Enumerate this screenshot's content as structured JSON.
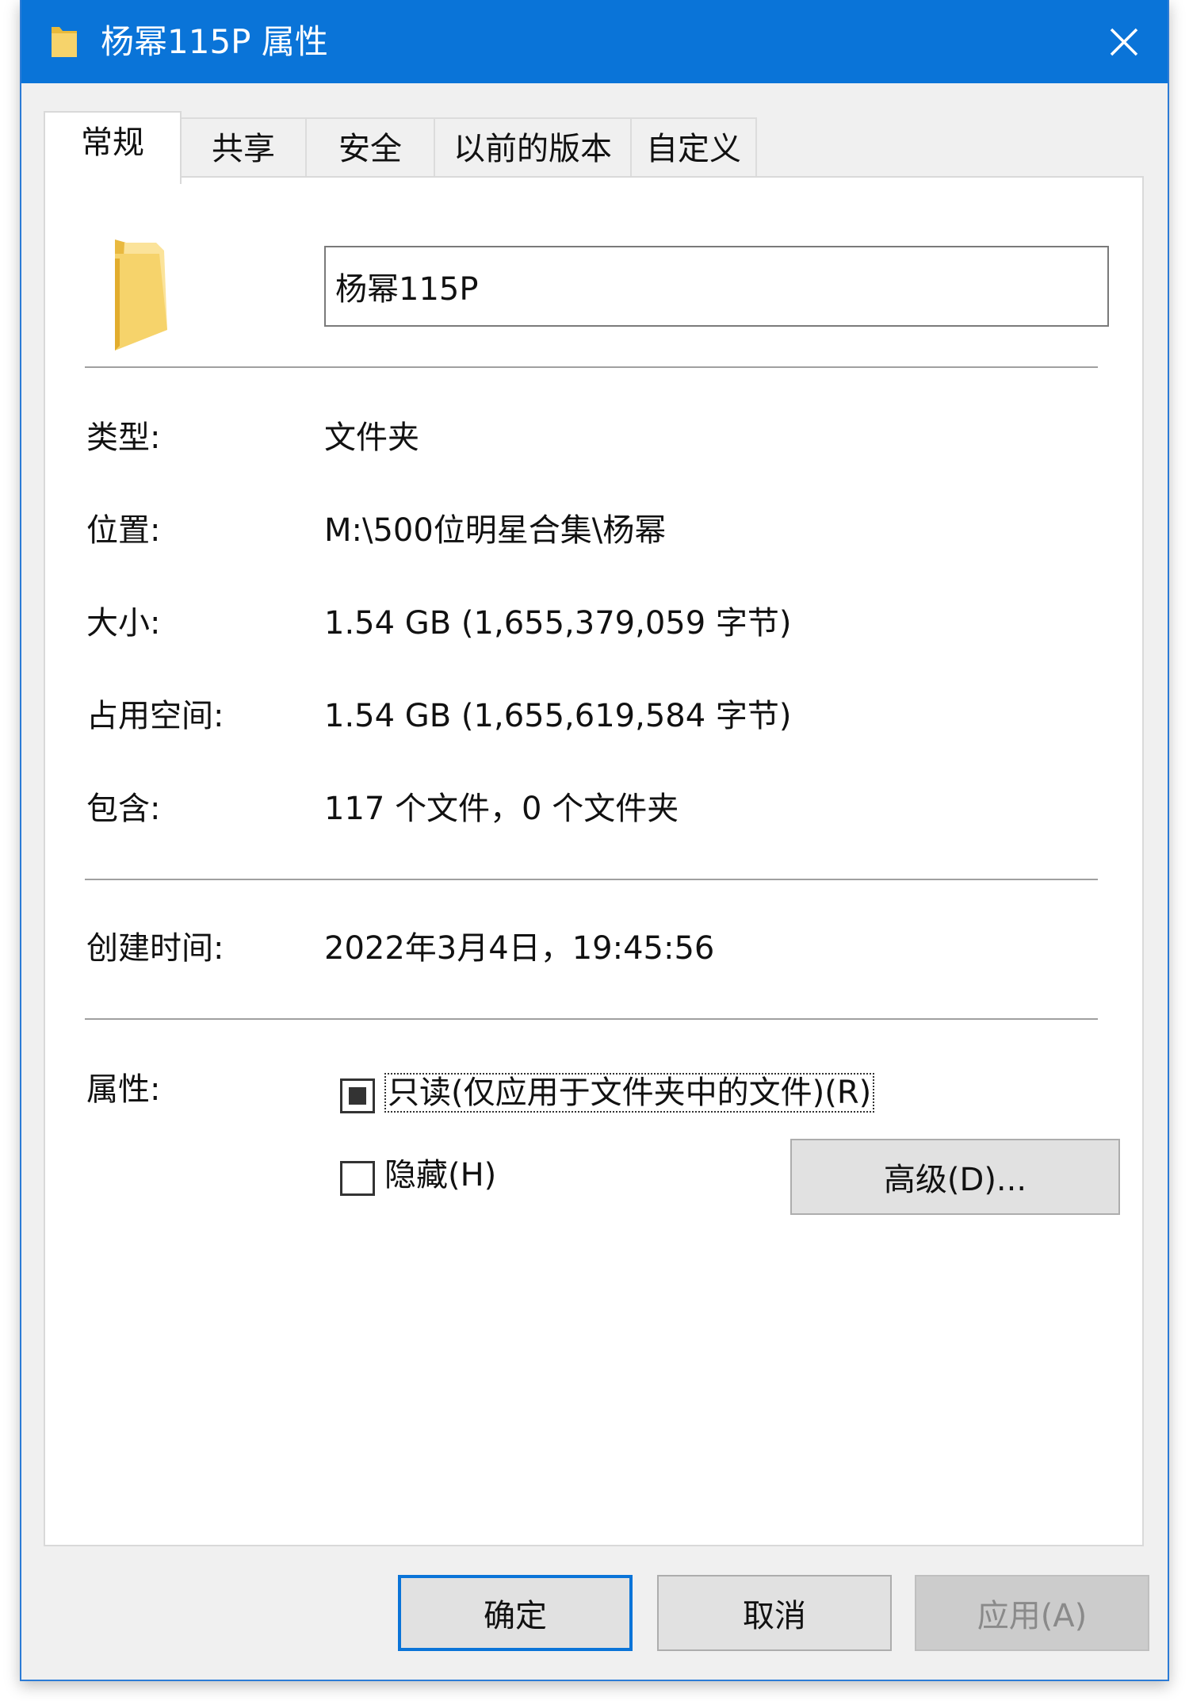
{
  "window": {
    "title": "杨幂115P 属性"
  },
  "tabs": [
    {
      "label": "常规",
      "active": true
    },
    {
      "label": "共享",
      "active": false
    },
    {
      "label": "安全",
      "active": false
    },
    {
      "label": "以前的版本",
      "active": false
    },
    {
      "label": "自定义",
      "active": false
    }
  ],
  "general": {
    "name_value": "杨幂115P",
    "rows": [
      {
        "label": "类型:",
        "value": "文件夹"
      },
      {
        "label": "位置:",
        "value": "M:\\500位明星合集\\杨幂"
      },
      {
        "label": "大小:",
        "value": "1.54 GB (1,655,379,059 字节)"
      },
      {
        "label": "占用空间:",
        "value": "1.54 GB (1,655,619,584 字节)"
      },
      {
        "label": "包含:",
        "value": "117 个文件，0 个文件夹"
      }
    ],
    "created": {
      "label": "创建时间:",
      "value": "2022年3月4日，19:45:56"
    },
    "attributes": {
      "label": "属性:",
      "readonly_label": "只读(仅应用于文件夹中的文件)(R)",
      "readonly_state": "indeterminate",
      "hidden_label": "隐藏(H)",
      "hidden_state": "unchecked",
      "advanced_button": "高级(D)..."
    }
  },
  "footer": {
    "ok": "确定",
    "cancel": "取消",
    "apply": "应用(A)"
  },
  "colors": {
    "titlebar": "#0a74d8",
    "folder": "#f6d36b"
  }
}
